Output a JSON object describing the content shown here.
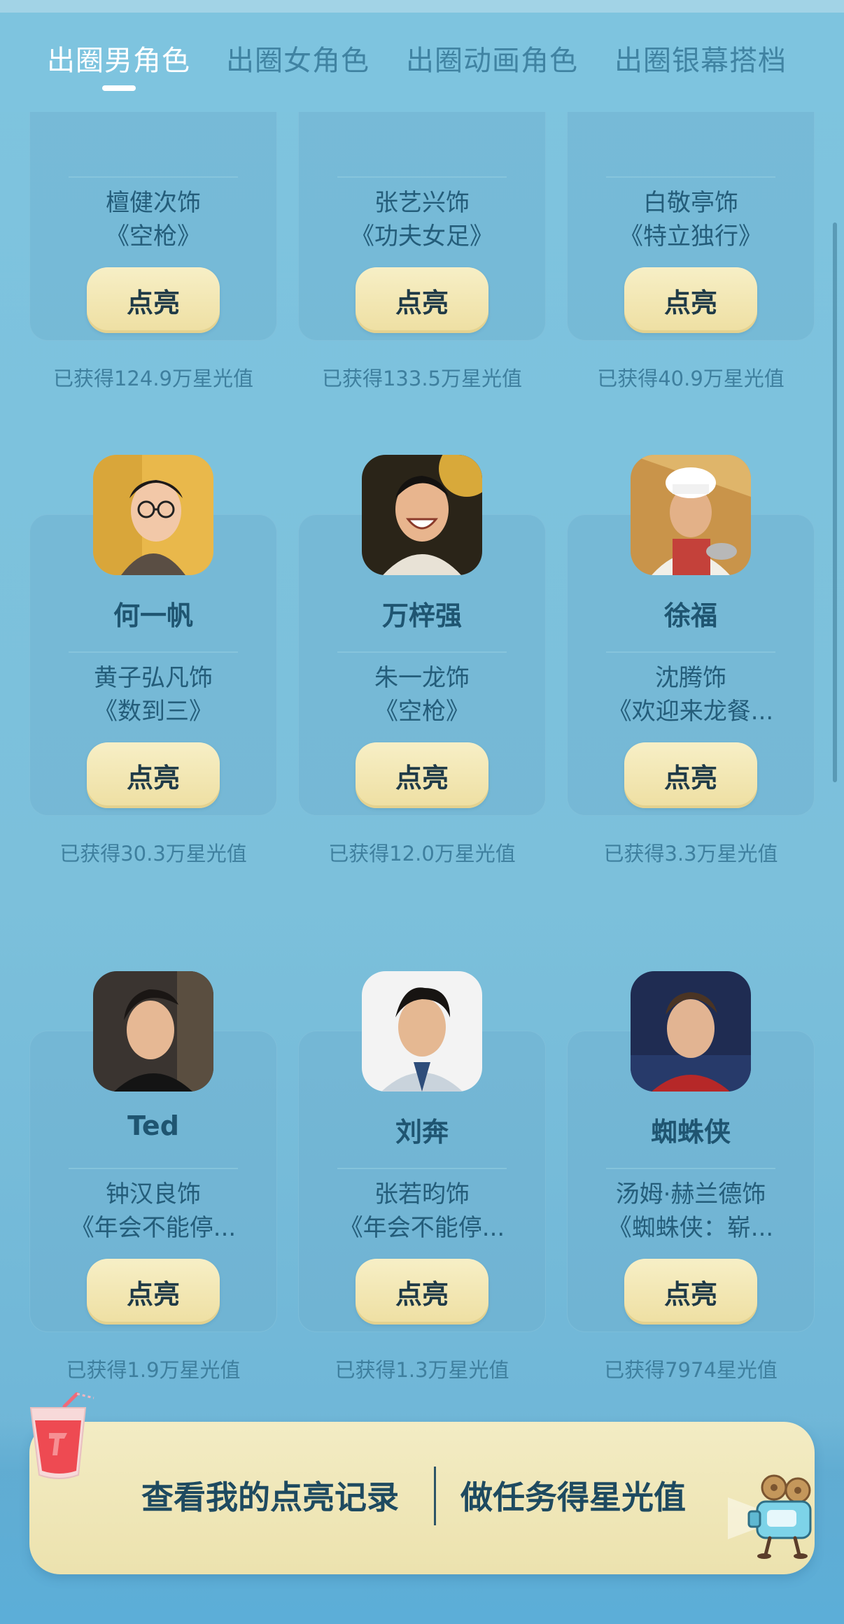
{
  "tabs": [
    {
      "label": "出圈男角色",
      "active": true
    },
    {
      "label": "出圈女角色",
      "active": false
    },
    {
      "label": "出圈动画角色",
      "active": false
    },
    {
      "label": "出圈银幕搭档",
      "active": false
    }
  ],
  "light_button_label": "点亮",
  "cards": [
    {
      "name": "",
      "actor": "檀健次饰",
      "film": "《空枪》",
      "stat": "已获得124.9万星光值",
      "avatar": "none"
    },
    {
      "name": "",
      "actor": "张艺兴饰",
      "film": "《功夫女足》",
      "stat": "已获得133.5万星光值",
      "avatar": "none"
    },
    {
      "name": "",
      "actor": "白敬亭饰",
      "film": "《特立独行》",
      "stat": "已获得40.9万星光值",
      "avatar": "none"
    },
    {
      "name": "何一帆",
      "actor": "黄子弘凡饰",
      "film": "《数到三》",
      "stat": "已获得30.3万星光值",
      "avatar": "portrait-glasses"
    },
    {
      "name": "万梓强",
      "actor": "朱一龙饰",
      "film": "《空枪》",
      "stat": "已获得12.0万星光值",
      "avatar": "portrait-laughing"
    },
    {
      "name": "徐福",
      "actor": "沈腾饰",
      "film": "《欢迎来龙餐...",
      "stat": "已获得3.3万星光值",
      "avatar": "portrait-chef"
    },
    {
      "name": "Ted",
      "actor": "钟汉良饰",
      "film": "《年会不能停...",
      "stat": "已获得1.9万星光值",
      "avatar": "portrait-dark"
    },
    {
      "name": "刘奔",
      "actor": "张若昀饰",
      "film": "《年会不能停...",
      "stat": "已获得1.3万星光值",
      "avatar": "portrait-office"
    },
    {
      "name": "蜘蛛侠",
      "actor": "汤姆·赫兰德饰",
      "film": "《蜘蛛侠：崭...",
      "stat": "已获得7974星光值",
      "avatar": "portrait-spiderman"
    }
  ],
  "bottom_bar": {
    "left_label": "查看我的点亮记录",
    "right_label": "做任务得星光值",
    "left_icon": "drink-cup-icon",
    "right_icon": "movie-camera-icon"
  },
  "colors": {
    "background": "#7ec2dd",
    "tab_active": "#ffffff",
    "button": "#f1e5b0",
    "text_dark": "#1f5571"
  }
}
